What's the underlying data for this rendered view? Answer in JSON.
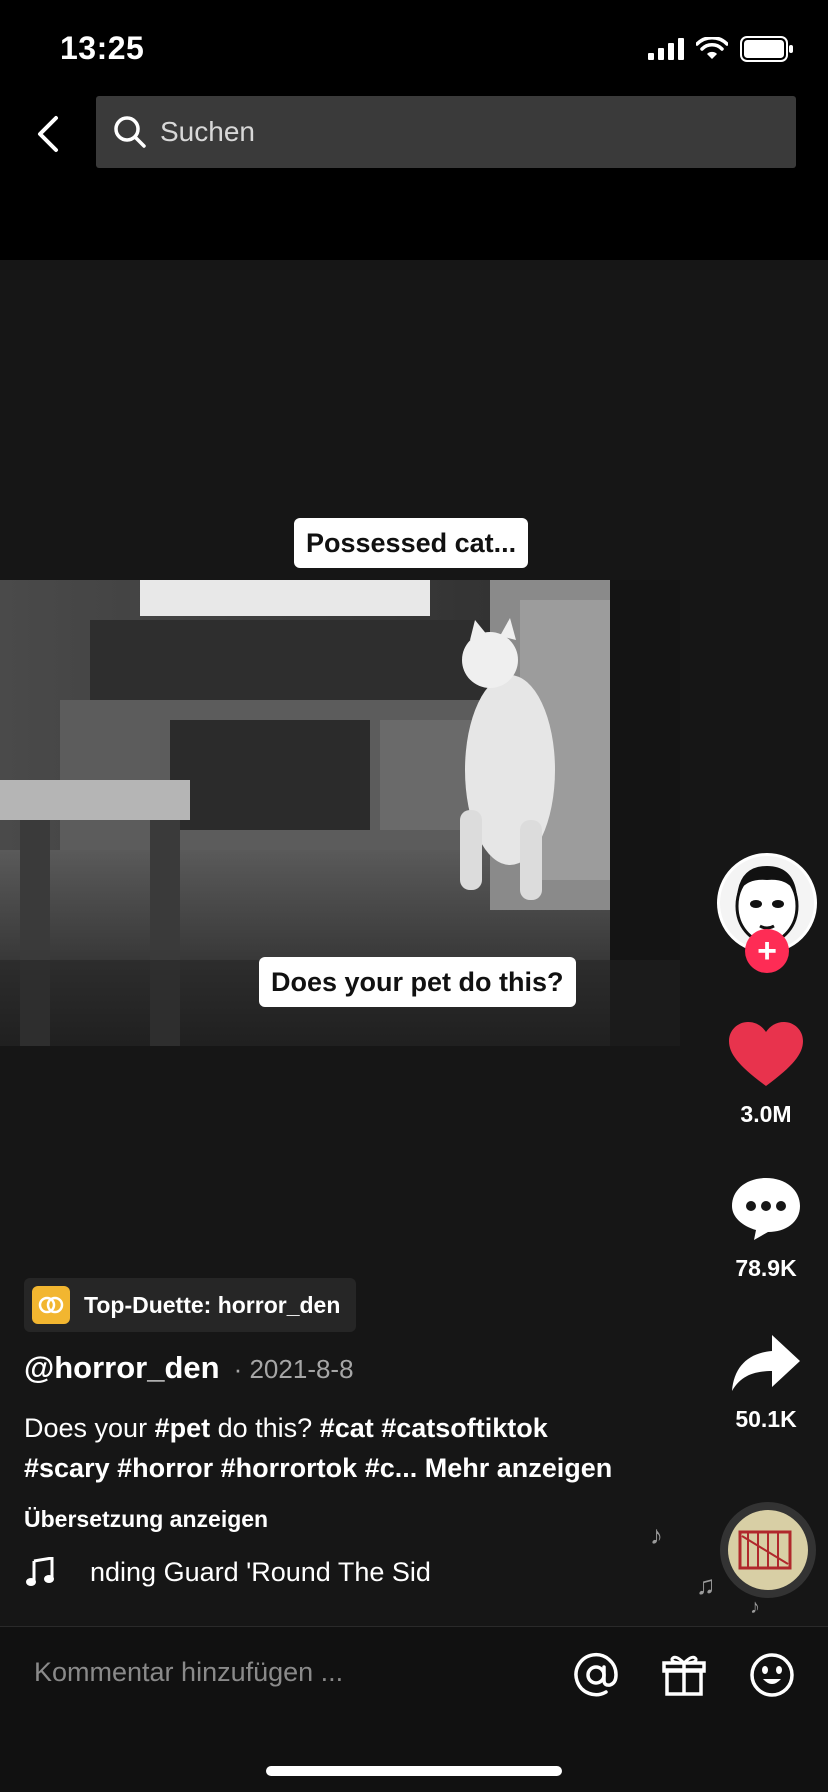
{
  "status_bar": {
    "time": "13:25"
  },
  "search": {
    "placeholder": "Suchen"
  },
  "video": {
    "caption_top": "Possessed cat...",
    "caption_bottom": "Does your pet do this?"
  },
  "actions": {
    "likes": "3.0M",
    "comments": "78.9K",
    "shares": "50.1K"
  },
  "duet": {
    "label": "Top-Duette: horror_den"
  },
  "post": {
    "username": "@horror_den",
    "date": "· 2021-8-8",
    "desc_parts": [
      {
        "t": "Does your ",
        "tag": false
      },
      {
        "t": "#pet",
        "tag": true
      },
      {
        "t": " do this? ",
        "tag": false
      },
      {
        "t": "#cat",
        "tag": true
      },
      {
        "t": " ",
        "tag": false
      },
      {
        "t": "#catsoftiktok",
        "tag": true
      },
      {
        "t": " ",
        "tag": false
      },
      {
        "t": "#scary",
        "tag": true
      },
      {
        "t": " ",
        "tag": false
      },
      {
        "t": "#horror",
        "tag": true
      },
      {
        "t": " ",
        "tag": false
      },
      {
        "t": "#horrortok",
        "tag": true
      },
      {
        "t": " ",
        "tag": false
      },
      {
        "t": "#c...",
        "tag": true
      }
    ],
    "more": "Mehr anzeigen",
    "translate": "Übersetzung anzeigen",
    "music": "nding Guard 'Round The Sid"
  },
  "comment_bar": {
    "placeholder": "Kommentar hinzufügen ..."
  },
  "colors": {
    "accent": "#fe2c55",
    "duet": "#f2b630"
  },
  "icons": [
    "back-icon",
    "search-icon",
    "signal-icon",
    "wifi-icon",
    "battery-icon",
    "heart-icon",
    "comment-icon",
    "share-icon",
    "music-note-icon",
    "at-icon",
    "gift-icon",
    "emoji-icon",
    "duet-icon"
  ]
}
